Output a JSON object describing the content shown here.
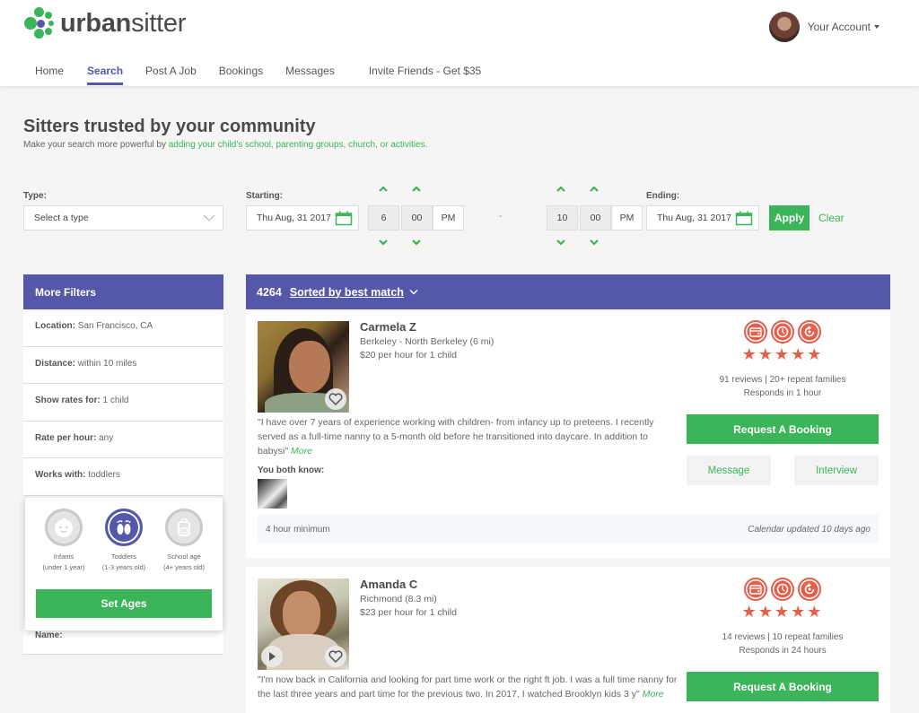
{
  "brand": {
    "name_bold": "urban",
    "name_light": "sitter",
    "colors": {
      "green": "#3cb45a",
      "purple": "#5557a9",
      "coral": "#e3604d"
    }
  },
  "nav": {
    "items": [
      {
        "label": "Home",
        "active": false
      },
      {
        "label": "Search",
        "active": true
      },
      {
        "label": "Post A Job",
        "active": false
      },
      {
        "label": "Bookings",
        "active": false
      },
      {
        "label": "Messages",
        "active": false
      },
      {
        "label": "Invite Friends - Get $35",
        "active": false
      }
    ]
  },
  "account": {
    "label": "Your Account"
  },
  "hero": {
    "title": "Sitters trusted by your community",
    "subtitle_prefix": "Make your search more powerful by ",
    "subtitle_link": "adding your child's school, parenting groups, church, or activities."
  },
  "search": {
    "type_label": "Type:",
    "type_placeholder": "Select a type",
    "starting_label": "Starting:",
    "starting_date": "Thu Aug, 31 2017",
    "start_hour": "6",
    "start_minute": "00",
    "start_ampm": "PM",
    "separator": "-",
    "end_hour": "10",
    "end_minute": "00",
    "end_ampm": "PM",
    "ending_label": "Ending:",
    "ending_date": "Thu Aug, 31 2017",
    "apply_label": "Apply",
    "clear_label": "Clear"
  },
  "filters": {
    "title": "More Filters",
    "rows": [
      {
        "key": "Location:",
        "value": "San Francisco, CA"
      },
      {
        "key": "Distance:",
        "value": "within 10 miles"
      },
      {
        "key": "Show rates for:",
        "value": "1 child"
      },
      {
        "key": "Rate per hour:",
        "value": "any"
      },
      {
        "key": "Works with:",
        "value": "toddlers"
      }
    ],
    "name_label": "Name:",
    "ages_popup": {
      "options": [
        {
          "name": "Infants",
          "range": "(under 1 year)",
          "selected": false,
          "icon": "baby-face-icon"
        },
        {
          "name": "Toddlers",
          "range": "(1-3 years old)",
          "selected": true,
          "icon": "footprints-icon"
        },
        {
          "name": "School age",
          "range": "(4+ years old)",
          "selected": false,
          "icon": "backpack-icon"
        }
      ],
      "button_label": "Set Ages"
    }
  },
  "results": {
    "count": "4264",
    "sort_label": "Sorted by best match",
    "sitters": [
      {
        "name": "Carmela Z",
        "location": "Berkeley - North Berkeley (6 mi)",
        "rate": "$20 per hour for 1 child",
        "bio": "\"I have over 7 years of experience working with children- from infancy up to preteens. I recently served as a full-time nanny to a 5-month old before he transitioned into daycare. In addition to babysi\"",
        "more_label": "More",
        "both_know_label": "You both know:",
        "badges": [
          "payment-card-icon",
          "clock-icon",
          "repeat-icon"
        ],
        "rating": 5,
        "reviews": "91 reviews | 20+ repeat families",
        "responds": "Responds in 1 hour",
        "book_label": "Request A Booking",
        "message_label": "Message",
        "interview_label": "Interview",
        "minimum": "4 hour minimum",
        "calendar_updated": "Calendar updated 10 days ago"
      },
      {
        "name": "Amanda C",
        "location": "Richmond (8.3 mi)",
        "rate": "$23 per hour for 1 child",
        "bio": "\"I'm now back in California and looking for part time work or the right ft job. I was a full time nanny for the last three years and part time for the previous two. In 2017, I watched Brooklyn kids 3 y\"",
        "more_label": "More",
        "badges": [
          "payment-card-icon",
          "clock-icon",
          "repeat-icon"
        ],
        "rating": 5,
        "reviews": "14 reviews | 10 repeat families",
        "responds": "Responds in 24 hours",
        "book_label": "Request A Booking"
      }
    ]
  }
}
